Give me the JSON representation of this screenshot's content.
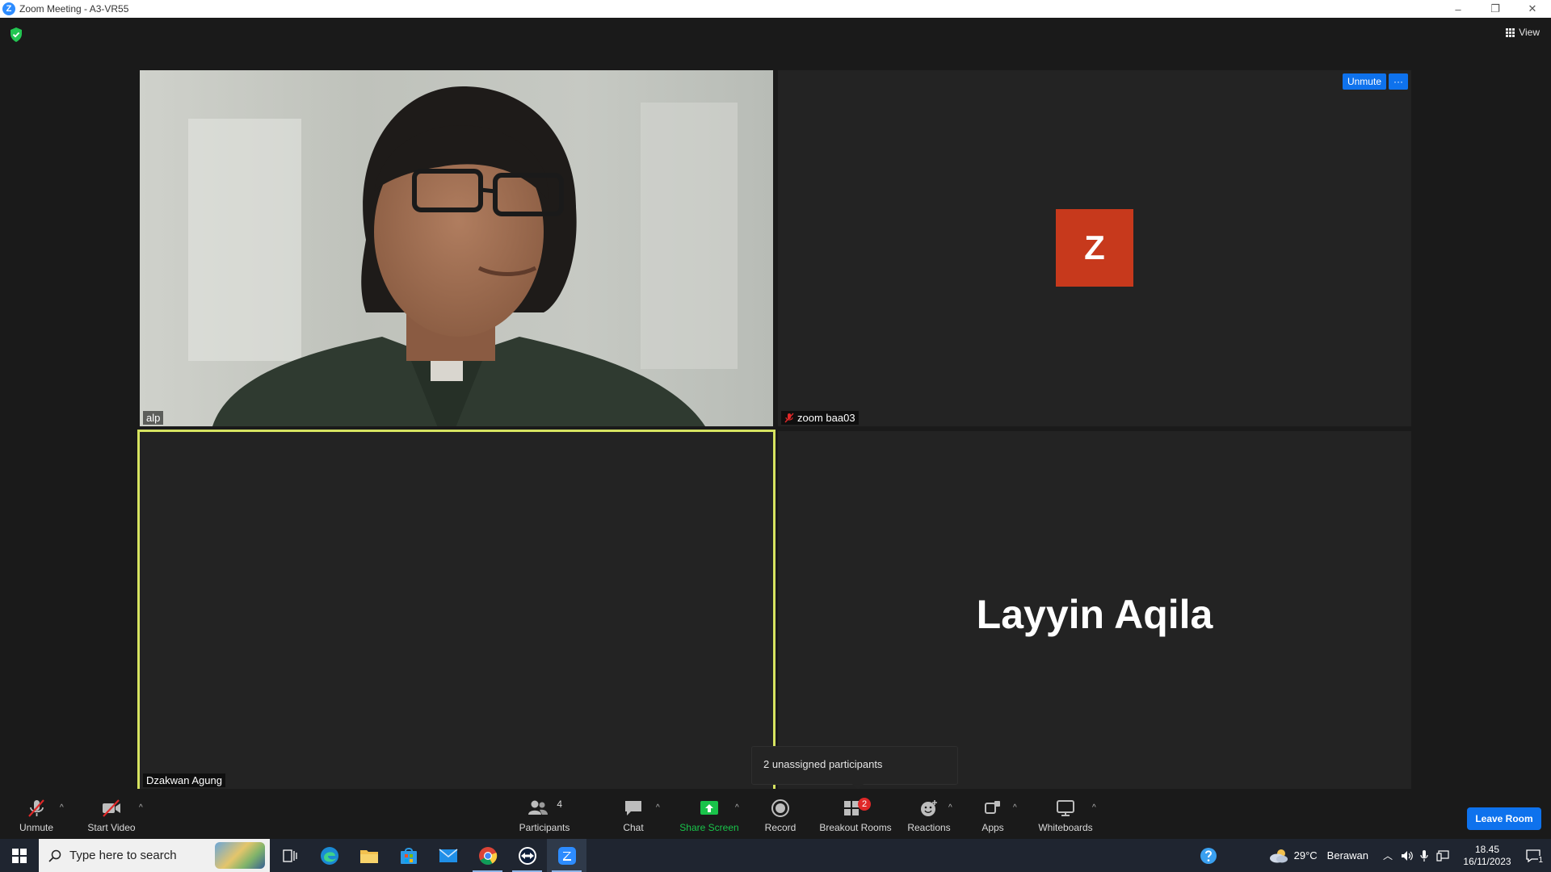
{
  "window": {
    "title": "Zoom Meeting - A3-VR55",
    "app_logo_letter": "Z",
    "minimize": "–",
    "restore": "❐",
    "close": "✕"
  },
  "meeting": {
    "view_label": "View",
    "tiles": [
      {
        "name": "alp",
        "muted": false
      },
      {
        "name": "zoom baa03",
        "muted": true,
        "avatar_letter": "Z",
        "avatar_color": "#c7391c",
        "unmute_label": "Unmute",
        "more_label": "···"
      },
      {
        "name": "Dzakwan Agung",
        "active_speaker": true,
        "border_color": "#d6e360"
      },
      {
        "name": "Layyin Aqila",
        "display_name_large": "Layyin Aqila"
      }
    ],
    "tooltip": "2 unassigned participants"
  },
  "toolbar": {
    "unmute": "Unmute",
    "start_video": "Start Video",
    "participants": "Participants",
    "participants_count": "4",
    "chat": "Chat",
    "share_screen": "Share Screen",
    "record": "Record",
    "breakout_rooms": "Breakout Rooms",
    "breakout_badge": "2",
    "reactions": "Reactions",
    "apps": "Apps",
    "whiteboards": "Whiteboards",
    "leave_room": "Leave Room",
    "caret": "^",
    "share_color": "#19c34a"
  },
  "taskbar": {
    "search_placeholder": "Type here to search",
    "weather_temp": "29°C",
    "weather_text": "Berawan",
    "time": "18.45",
    "date": "16/11/2023",
    "notification_count": "1",
    "taskbar_color": "#1f2530"
  }
}
